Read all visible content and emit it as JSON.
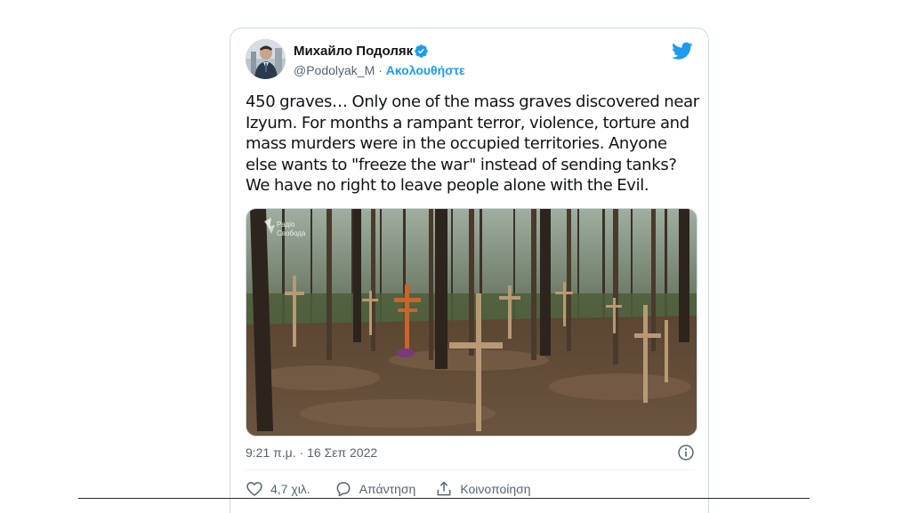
{
  "author": {
    "name": "Михайло Подоляк",
    "handle": "@Podolyak_M",
    "separator": "·",
    "follow_label": "Ακολουθήστε",
    "verified": true
  },
  "tweet": {
    "text": "450 graves… Only one of the mass graves discovered near Izyum. For months a rampant terror, violence, torture and mass murders were in the occupied territories. Anyone else wants to \"freeze the war\" instead of sending tanks? We have no right to leave people alone with the Evil.",
    "photo_watermark": "Радіо Свобода",
    "timestamp": "9:21 π.μ. · 16 Σεπ 2022"
  },
  "actions": {
    "like_count": "4,7 χιλ.",
    "reply_label": "Απάντηση",
    "share_label": "Κοινοποίηση"
  },
  "icons": {
    "brand": "twitter-bird-icon",
    "verified": "verified-badge-icon",
    "info": "info-icon",
    "like": "heart-icon",
    "reply": "speech-bubble-icon",
    "share": "share-icon"
  },
  "colors": {
    "accent": "#1d9bf0",
    "text_primary": "#0f1419",
    "text_secondary": "#536471",
    "border": "#cfd9de"
  }
}
